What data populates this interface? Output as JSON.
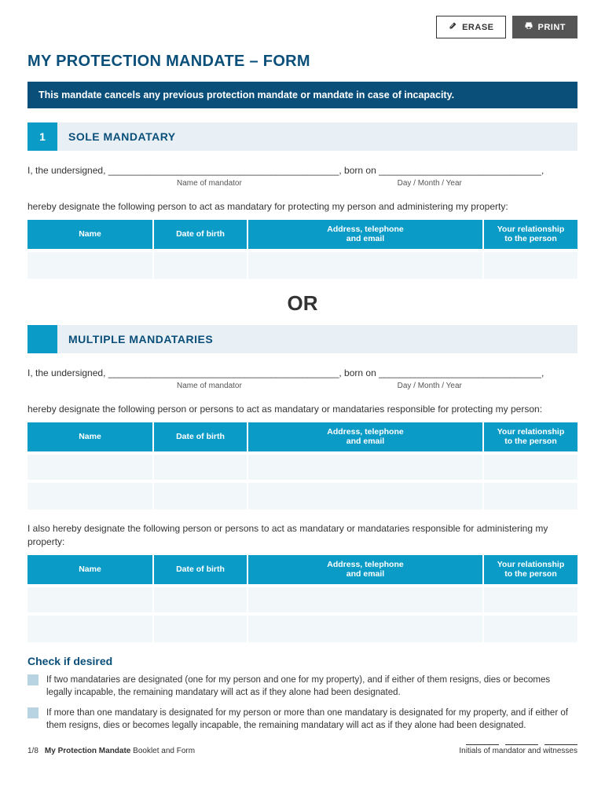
{
  "toolbar": {
    "erase_label": "ERASE",
    "print_label": "PRINT"
  },
  "title": "MY PROTECTION MANDATE – FORM",
  "banner": "This mandate cancels any previous protection mandate or mandate in case of incapacity.",
  "section1": {
    "num": "1",
    "title": "SOLE MANDATARY",
    "line": "I, the undersigned, ____________________________________________, born on _______________________________,",
    "sub1": "Name of mandator",
    "sub2": "Day / Month / Year",
    "desc": "hereby designate the following person to act as mandatary for protecting my person and administering my property:"
  },
  "table_headers": {
    "name": "Name",
    "dob": "Date of birth",
    "addr": "Address, telephone\nand email",
    "rel": "Your relationship\nto the person"
  },
  "or_text": "OR",
  "section2": {
    "title": "MULTIPLE MANDATARIES",
    "line": "I, the undersigned, ____________________________________________, born on _______________________________,",
    "sub1": "Name of mandator",
    "sub2": "Day / Month / Year",
    "desc1": "hereby designate the following person or persons to act as mandatary or mandataries responsible for protecting my person:",
    "desc2": "I also hereby designate the following person or persons to act as mandatary or mandataries responsible for administering my property:"
  },
  "check": {
    "heading": "Check if desired",
    "item1": "If two mandataries are designated (one for my person and one for my property), and if either of them resigns, dies or becomes legally incapable, the remaining mandatary will act as if they alone had been designated.",
    "item2": "If more than one mandatary is designated for my person or more than one mandatary is designated for my property, and if either of them resigns, dies or becomes legally incapable, the remaining mandatary will act as if they alone had been designated."
  },
  "footer": {
    "page": "1/8",
    "doc_bold": "My Protection Mandate",
    "doc_rest": " Booklet and Form",
    "initials": "Initials of mandator and witnesses"
  }
}
